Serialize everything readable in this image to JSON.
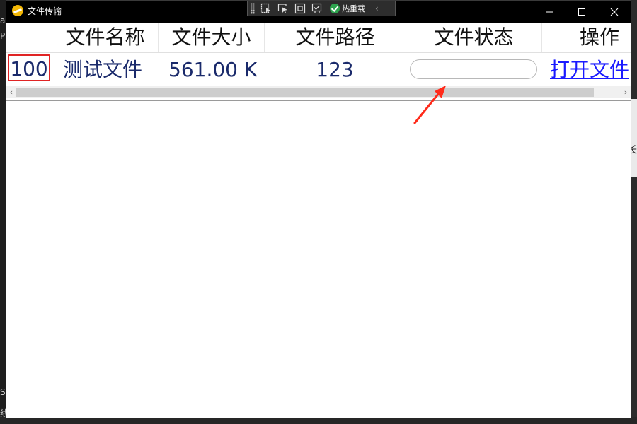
{
  "window": {
    "title": "文件传输"
  },
  "debug_toolbar": {
    "hot_reload_label": "热重载",
    "icons": [
      "select-element-icon",
      "pointer-icon",
      "frame-icon",
      "refresh-check-icon"
    ]
  },
  "grid": {
    "columns": [
      {
        "key": "id",
        "label": ""
      },
      {
        "key": "name",
        "label": "文件名称"
      },
      {
        "key": "size",
        "label": "文件大小"
      },
      {
        "key": "path",
        "label": "文件路径"
      },
      {
        "key": "status",
        "label": "文件状态"
      },
      {
        "key": "action",
        "label": "操作"
      }
    ],
    "rows": [
      {
        "id": "100",
        "name": "测试文件",
        "size": "561.00 K",
        "path": "123",
        "status_progress": 0,
        "action": "打开文件"
      }
    ]
  },
  "colors": {
    "accent_link": "#1a1aff",
    "cell_text": "#1a2a6b",
    "highlight_box": "#e02424",
    "annotation_arrow": "#ff2a1a"
  },
  "background": {
    "left_glyphs": [
      "a",
      "P",
      "S",
      "线"
    ],
    "right_glyph": "长"
  }
}
